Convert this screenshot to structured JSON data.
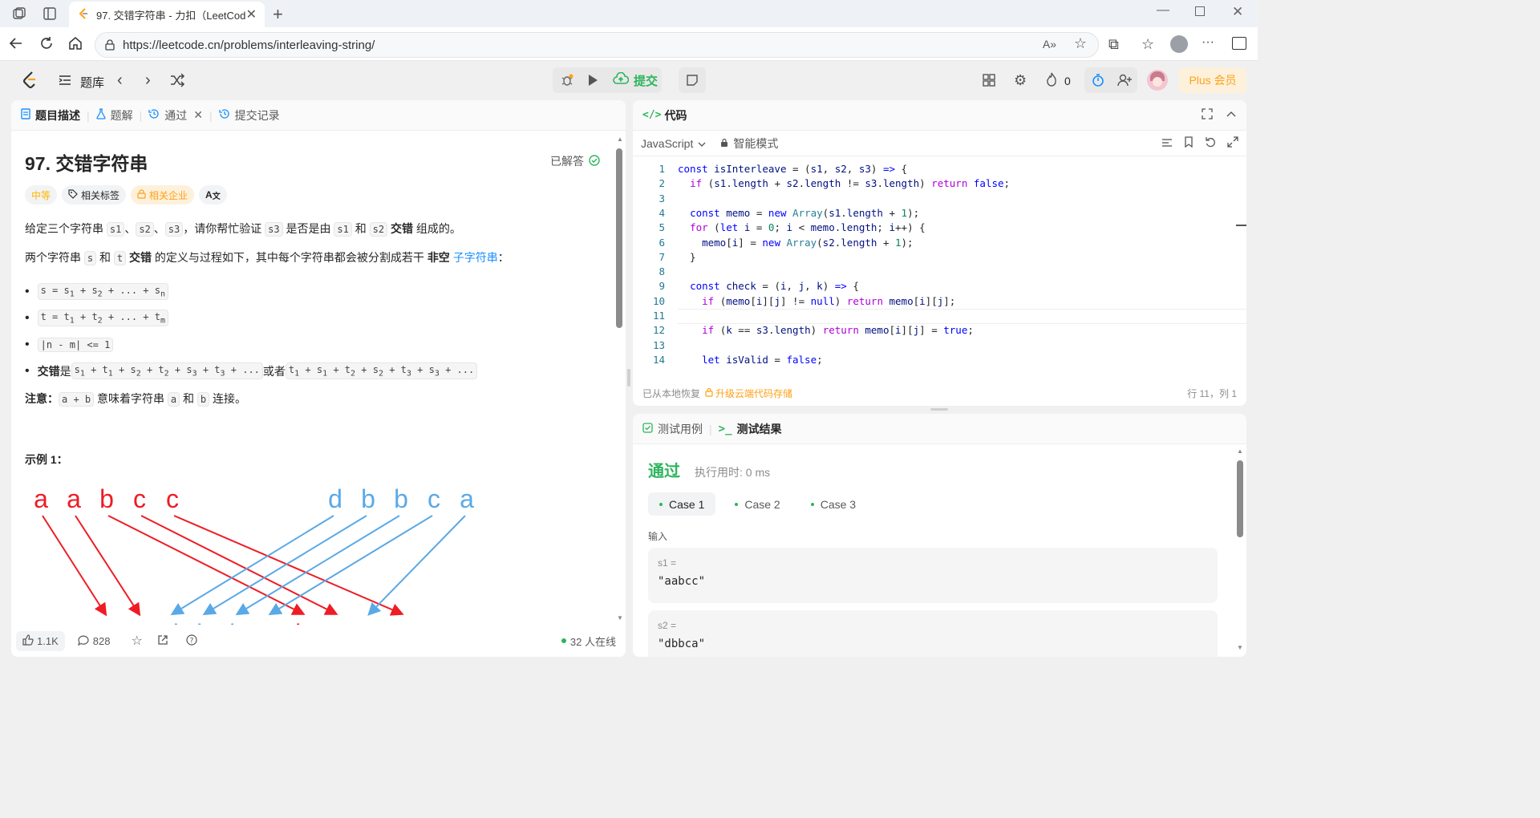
{
  "browser": {
    "tab_title": "97. 交错字符串 - 力扣（LeetCode",
    "url": "https://leetcode.cn/problems/interleaving-string/"
  },
  "nav": {
    "problem_bank": "题库",
    "submit": "提交",
    "fire_count": "0",
    "plus": "Plus 会员"
  },
  "left_tabs": [
    "题目描述",
    "题解",
    "通过",
    "提交记录"
  ],
  "problem": {
    "title": "97. 交错字符串",
    "solved": "已解答",
    "difficulty": "中等",
    "tag_related": "相关标签",
    "tag_company": "相关企业",
    "p1_a": "给定三个字符串 ",
    "s1": "s1",
    "sep": "、",
    "s2": "s2",
    "s3": "s3",
    "p1_b": "，请你帮忙验证 ",
    "p1_c": " 是否是由 ",
    "p1_and": " 和 ",
    "p1_bold": "交错",
    "p1_d": " 组成的。",
    "p2_a": "两个字符串 ",
    "s": "s",
    "t": "t",
    "p2_b": " 的定义与过程如下，其中每个字符串都会被分割成若干 ",
    "p2_bold": "非空",
    "p2_link": "子字符串",
    "colon": "：",
    "b3": "|n - m| <= 1",
    "b4_bold": "交错",
    "b4_is": " 是 ",
    "b4_or": " 或者 ",
    "note_bold": "注意：",
    "note_code": "a + b",
    "note_a": " 意味着字符串 ",
    "a": "a",
    "b": "b",
    "note_b": " 连接。",
    "example": "示例 1："
  },
  "diagram": {
    "top_left": [
      "a",
      "a",
      "b",
      "c",
      "c"
    ],
    "top_right": [
      "d",
      "b",
      "b",
      "c",
      "a"
    ],
    "bottom": [
      "a",
      "a",
      "d",
      "b",
      "b",
      "c",
      "b",
      "c",
      "a",
      "c"
    ]
  },
  "footer": {
    "likes": "1.1K",
    "comments": "828",
    "online": "32 人在线"
  },
  "editor": {
    "header": "代码",
    "language": "JavaScript",
    "mode": "智能模式",
    "status_left": "已从本地恢复",
    "upgrade": "升级云端代码存储",
    "cursor": "行 11，列 1"
  },
  "code_lines": [
    "const isInterleave = (s1, s2, s3) => {",
    "  if (s1.length + s2.length != s3.length) return false;",
    "",
    "  const memo = new Array(s1.length + 1);",
    "  for (let i = 0; i < memo.length; i++) {",
    "    memo[i] = new Array(s2.length + 1);",
    "  }",
    "",
    "  const check = (i, j, k) => {",
    "    if (memo[i][j] != null) return memo[i][j];",
    "",
    "    if (k == s3.length) return memo[i][j] = true;",
    "",
    "    let isValid = false;"
  ],
  "result": {
    "tab_cases": "测试用例",
    "tab_result": "测试结果",
    "status": "通过",
    "runtime": "执行用时: 0 ms",
    "cases": [
      "Case 1",
      "Case 2",
      "Case 3"
    ],
    "input_label": "输入",
    "in1_label": "s1 =",
    "in1_value": "\"aabcc\"",
    "in2_label": "s2 =",
    "in2_value": "\"dbbca\""
  },
  "colors": {
    "accent_green": "#2db55d",
    "link_blue": "#1a90ff",
    "orange": "#ffa116",
    "diagram_red": "#ee1c25",
    "diagram_blue": "#5aa9e6"
  }
}
